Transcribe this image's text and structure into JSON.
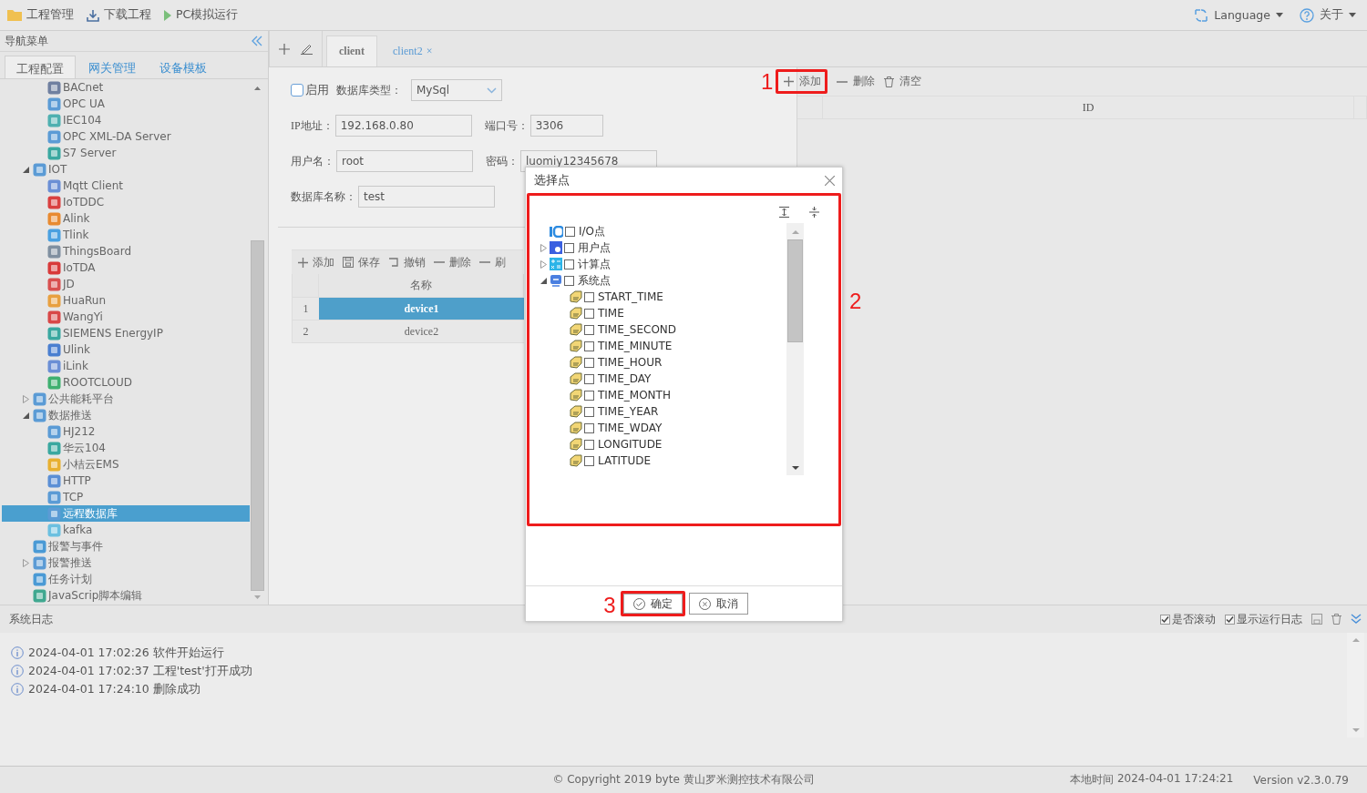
{
  "toolbar": {
    "items": [
      {
        "label": "工程管理"
      },
      {
        "label": "下载工程"
      },
      {
        "label": "PC模拟运行"
      }
    ],
    "menus": [
      {
        "label": "Language"
      },
      {
        "label": "关于"
      }
    ]
  },
  "nav": {
    "title": "导航菜单",
    "tabs": [
      {
        "label": "工程配置",
        "selected": true
      },
      {
        "label": "网关管理",
        "selected": false
      },
      {
        "label": "设备模板",
        "selected": false
      }
    ],
    "tree": [
      {
        "children": [
          {
            "label": "BACnet",
            "selected": false
          },
          {
            "label": "OPC UA",
            "selected": false
          },
          {
            "label": "IEC104",
            "selected": false
          },
          {
            "label": "OPC XML-DA Server",
            "selected": false
          },
          {
            "label": "S7 Server",
            "selected": false
          }
        ]
      },
      {
        "label": "IOT",
        "expanded": true,
        "selected": false,
        "children": [
          {
            "label": "Mqtt Client",
            "selected": false
          },
          {
            "label": "IoTDDC",
            "selected": false
          },
          {
            "label": "Alink",
            "selected": false
          },
          {
            "label": "Tlink",
            "selected": false
          },
          {
            "label": "ThingsBoard",
            "selected": false
          },
          {
            "label": "IoTDA",
            "selected": false
          },
          {
            "label": "JD",
            "selected": false
          },
          {
            "label": "HuaRun",
            "selected": false
          },
          {
            "label": "WangYi",
            "selected": false
          },
          {
            "label": "SIEMENS EnergyIP",
            "selected": false
          },
          {
            "label": "Ulink",
            "selected": false
          },
          {
            "label": "iLink",
            "selected": false
          },
          {
            "label": "ROOTCLOUD",
            "selected": false
          }
        ]
      },
      {
        "label": "公共能耗平台",
        "expanded": false,
        "selected": false
      },
      {
        "label": "数据推送",
        "expanded": true,
        "selected": false,
        "children": [
          {
            "label": "HJ212",
            "selected": false
          },
          {
            "label": "华云104",
            "selected": false
          },
          {
            "label": "小桔云EMS",
            "selected": false
          },
          {
            "label": "HTTP",
            "selected": false
          },
          {
            "label": "TCP",
            "selected": false
          },
          {
            "label": "远程数据库",
            "selected": true
          },
          {
            "label": "kafka",
            "selected": false
          }
        ]
      },
      {
        "label": "报警与事件",
        "selected": false
      },
      {
        "label": "报警推送",
        "expanded": false,
        "selected": false
      },
      {
        "label": "任务计划",
        "selected": false
      },
      {
        "label": "JavaScrip脚本编辑",
        "selected": false
      }
    ]
  },
  "editor": {
    "tabs": [
      {
        "label": "client",
        "selected": true
      },
      {
        "label": "client2",
        "selected": false,
        "close": "×"
      }
    ],
    "enable": {
      "label": "启用",
      "checked": false
    },
    "db_type": {
      "label": "数据库类型：",
      "value": "MySql"
    },
    "fields": [
      {
        "label": "IP地址：",
        "value": "192.168.0.80"
      },
      {
        "label": "端口号：",
        "value": "3306"
      },
      {
        "label": "用户名：",
        "value": "root"
      },
      {
        "label": "密码：",
        "value": "luomiy12345678"
      },
      {
        "label": "数据库名称：",
        "value": "test"
      }
    ],
    "device_grid": {
      "toolbar": [
        "添加",
        "保存",
        "撤销",
        "删除",
        "刷"
      ],
      "columns": [
        "名称"
      ],
      "rows": [
        {
          "index": "1",
          "name": "device1",
          "selected": true
        },
        {
          "index": "2",
          "name": "device2",
          "selected": false
        }
      ]
    },
    "points_grid": {
      "toolbar": [
        "添加",
        "删除",
        "清空"
      ],
      "columns": [
        "ID"
      ]
    }
  },
  "dialog": {
    "title": "选择点",
    "tree": [
      {
        "label": "I/O点",
        "checked": false
      },
      {
        "label": "用户点",
        "checked": false,
        "expanded": false
      },
      {
        "label": "计算点",
        "checked": false,
        "expanded": false
      },
      {
        "label": "系统点",
        "checked": false,
        "expanded": true,
        "children": [
          {
            "label": "START_TIME",
            "checked": false
          },
          {
            "label": "TIME",
            "checked": false
          },
          {
            "label": "TIME_SECOND",
            "checked": false
          },
          {
            "label": "TIME_MINUTE",
            "checked": false
          },
          {
            "label": "TIME_HOUR",
            "checked": false
          },
          {
            "label": "TIME_DAY",
            "checked": false
          },
          {
            "label": "TIME_MONTH",
            "checked": false
          },
          {
            "label": "TIME_YEAR",
            "checked": false
          },
          {
            "label": "TIME_WDAY",
            "checked": false
          },
          {
            "label": "LONGITUDE",
            "checked": false
          },
          {
            "label": "LATITUDE",
            "checked": false
          }
        ]
      }
    ],
    "buttons": [
      "确定",
      "取消"
    ]
  },
  "annotations": [
    {
      "number": "1"
    },
    {
      "number": "2"
    },
    {
      "number": "3"
    }
  ],
  "log": {
    "title": "系统日志",
    "options": [
      {
        "label": "是否滚动",
        "checked": true
      },
      {
        "label": "显示运行日志",
        "checked": true
      }
    ],
    "entries": [
      "2024-04-01 17:02:26 软件开始运行",
      "2024-04-01 17:02:37 工程'test'打开成功",
      "2024-04-01 17:24:10 删除成功"
    ]
  },
  "footer": {
    "copyright": "© Copyright 2019 byte 黄山罗米测控技术有限公司",
    "clock_label": "本地时间",
    "clock": "2024-04-01 17:24:21",
    "version": "Version v2.3.0.79"
  }
}
